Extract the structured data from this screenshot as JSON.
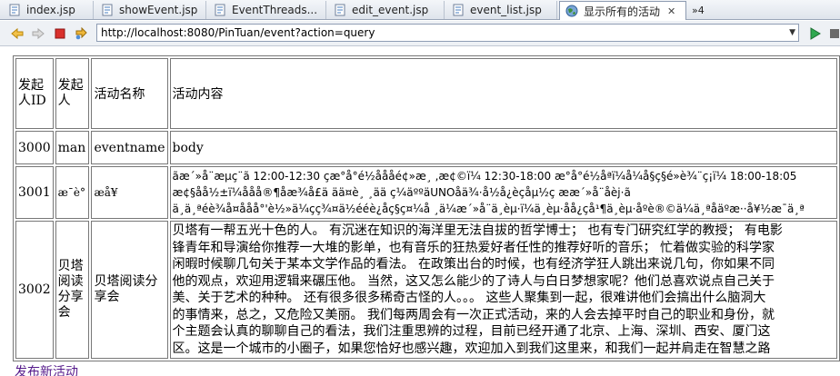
{
  "tabs": [
    {
      "label": "index.jsp"
    },
    {
      "label": "showEvent.jsp"
    },
    {
      "label": "EventThreads..."
    },
    {
      "label": "edit_event.jsp"
    },
    {
      "label": "event_list.jsp"
    },
    {
      "label": "显示所有的活动",
      "active": true,
      "close": "✕"
    }
  ],
  "tab_overflow": "»4",
  "address_bar": {
    "url": "http://localhost:8080/PinTuan/event?action=query"
  },
  "table": {
    "headers": [
      "发起人ID",
      "发起人",
      "活动名称",
      "活动内容"
    ],
    "rows": [
      {
        "id": "3000",
        "initiator": "man",
        "name": "eventname",
        "content": [
          "body"
        ]
      },
      {
        "id": "3001",
        "initiator": "æ¯è°",
        "name": "æå¥",
        "content": [
          "ãæ´»å¨æµç¨ã 12:00-12:30 çæ°å°é½åååé¢»æ¸ ,æ¢©ï¼ 12:30-18:00 æ°å°é½åªï¼å¼å§ç§é»è¾¨ç¡ï¼ 18:00-18:05",
          "æ¢§åå½±ï¼ååå®¶åæ¾å£ä ää¤è¸ ¸ää ç¼äººäUNOåä¾·å½å¿èçåµ½ç ææ´»å¨åèj·ã",
          "ä¸ä¸ªéè¾å¤ååå°'è½»ä¼çç¾¤ä½ééè¿åç§ç¤¼å ¸ä¼æ´»å¨ä¸èµ·ï¼ä¸èµ·åå¿çå¹¶ä¸èµ·åºè®©ä¼ä¸ªåäºæ··å¥½æ¯ä¸ª"
        ]
      },
      {
        "id": "3002",
        "initiator": "贝塔阅读分享会",
        "name": "贝塔阅读分享会",
        "content": [
          "贝塔有一帮五光十色的人。 有沉迷在知识的海洋里无法自拔的哲学博士； 也有专门研究红学的教授； 有电影",
          "锋青年和导演给你推荐一大堆的影单，也有音乐的狂热爱好者任性的推荐好听的音乐； 忙着做实验的科学家",
          "闲暇时候聊几句关于某本文学作品的看法。 在政策出台的时候，也有经济学狂人跳出来说几句，你如果不同",
          "他的观点，欢迎用逻辑来碾压他。 当然，这又怎么能少的了诗人与白日梦想家呢？他们总喜欢说点自己关于",
          "美、关于艺术的种种。 还有很多很多稀奇古怪的人。。。 这些人聚集到一起，很难讲他们会搞出什么脑洞大",
          "的事情来，总之，又危险又美丽。 我们每两周会有一次正式活动，来的人会去掉平时自己的职业和身份，就",
          "个主题会认真的聊聊自己的看法，我们注重思辨的过程，目前已经开通了北京、上海、深圳、西安、厦门这",
          "区。这是一个城市的小圈子，如果您恰好也感兴趣，欢迎加入到我们这里来，和我们一起并肩走在智慧之路"
        ]
      }
    ]
  },
  "add_link": "发布新活动"
}
